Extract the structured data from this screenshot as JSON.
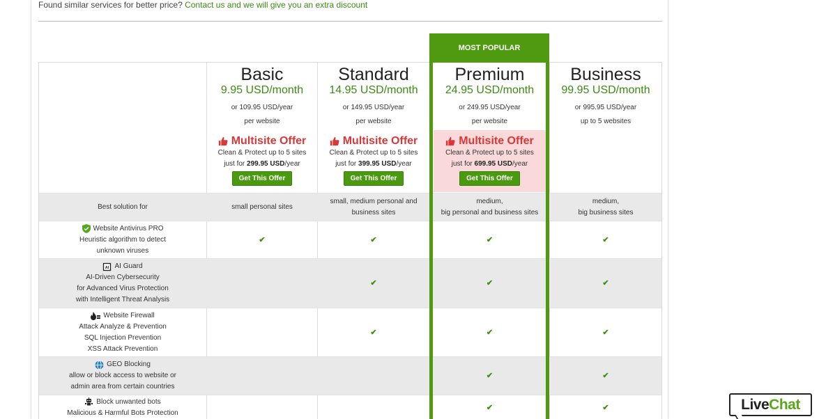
{
  "intro": {
    "text": "Found similar services for better price?",
    "link": "Contact us and we will give you an extra discount"
  },
  "popular_label": "MOST POPULAR",
  "plans": [
    {
      "name": "Basic",
      "price": "9.95 USD/month",
      "year": "or 109.95 USD/year",
      "scope": "per website",
      "offer_title": "Multisite Offer",
      "offer_line1": "Clean & Protect up to 5 sites",
      "offer_prefix": "just for",
      "offer_price": "299.95 USD",
      "offer_suffix": "/year",
      "offer_button": "Get This Offer"
    },
    {
      "name": "Standard",
      "price": "14.95 USD/month",
      "year": "or 149.95 USD/year",
      "scope": "per website",
      "offer_title": "Multisite Offer",
      "offer_line1": "Clean & Protect up to 5 sites",
      "offer_prefix": "just for",
      "offer_price": "399.95 USD",
      "offer_suffix": "/year",
      "offer_button": "Get This Offer"
    },
    {
      "name": "Premium",
      "price": "24.95 USD/month",
      "year": "or 249.95 USD/year",
      "scope": "per website",
      "offer_title": "Multisite Offer",
      "offer_line1": "Clean & Protect up to 5 sites",
      "offer_prefix": "just for",
      "offer_price": "699.95 USD",
      "offer_suffix": "/year",
      "offer_button": "Get This Offer"
    },
    {
      "name": "Business",
      "price": "99.95 USD/month",
      "year": "or 995.95 USD/year",
      "scope": "up to 5 websites"
    }
  ],
  "best_solution": {
    "label": "Best solution for",
    "basic": "small personal sites",
    "standard": [
      "small, medium personal and",
      "business sites"
    ],
    "premium": [
      "medium,",
      "big personal and business sites"
    ],
    "business": [
      "medium,",
      "big business sites"
    ]
  },
  "features": [
    {
      "icon": "shield-icon",
      "title": "Website Antivirus PRO",
      "lines": [
        "Heuristic algorithm to detect",
        "unknown viruses"
      ],
      "checks": [
        true,
        true,
        true,
        true
      ]
    },
    {
      "icon": "ai-chip-icon",
      "title": "AI Guard",
      "lines": [
        "AI-Driven Cybersecurity",
        "for Advanced Virus Protection",
        "with Intelligent Threat Analysis"
      ],
      "checks": [
        false,
        true,
        true,
        true
      ]
    },
    {
      "icon": "firewall-icon",
      "title": "Website Firewall",
      "lines": [
        "Attack Analyze & Prevention",
        "SQL Injection Prevention",
        "XSS Attack Prevention"
      ],
      "checks": [
        false,
        true,
        true,
        true
      ]
    },
    {
      "icon": "globe-icon",
      "title": "GEO Blocking",
      "lines": [
        "allow or block access to website or",
        "admin area from certain countries"
      ],
      "checks": [
        false,
        false,
        true,
        true
      ]
    },
    {
      "icon": "robot-icon",
      "title": "Block unwanted bots",
      "lines": [
        "Malicious & Harmful Bots Protection"
      ],
      "checks": [
        false,
        false,
        true,
        true
      ]
    }
  ],
  "check_glyph": "✔",
  "livechat": {
    "live": "Live",
    "chat": "Chat"
  },
  "colors": {
    "accent_green": "#4f9a10",
    "price_green": "#3b8a12",
    "offer_red": "#d93838",
    "offer_pink": "#f9d9d9"
  }
}
